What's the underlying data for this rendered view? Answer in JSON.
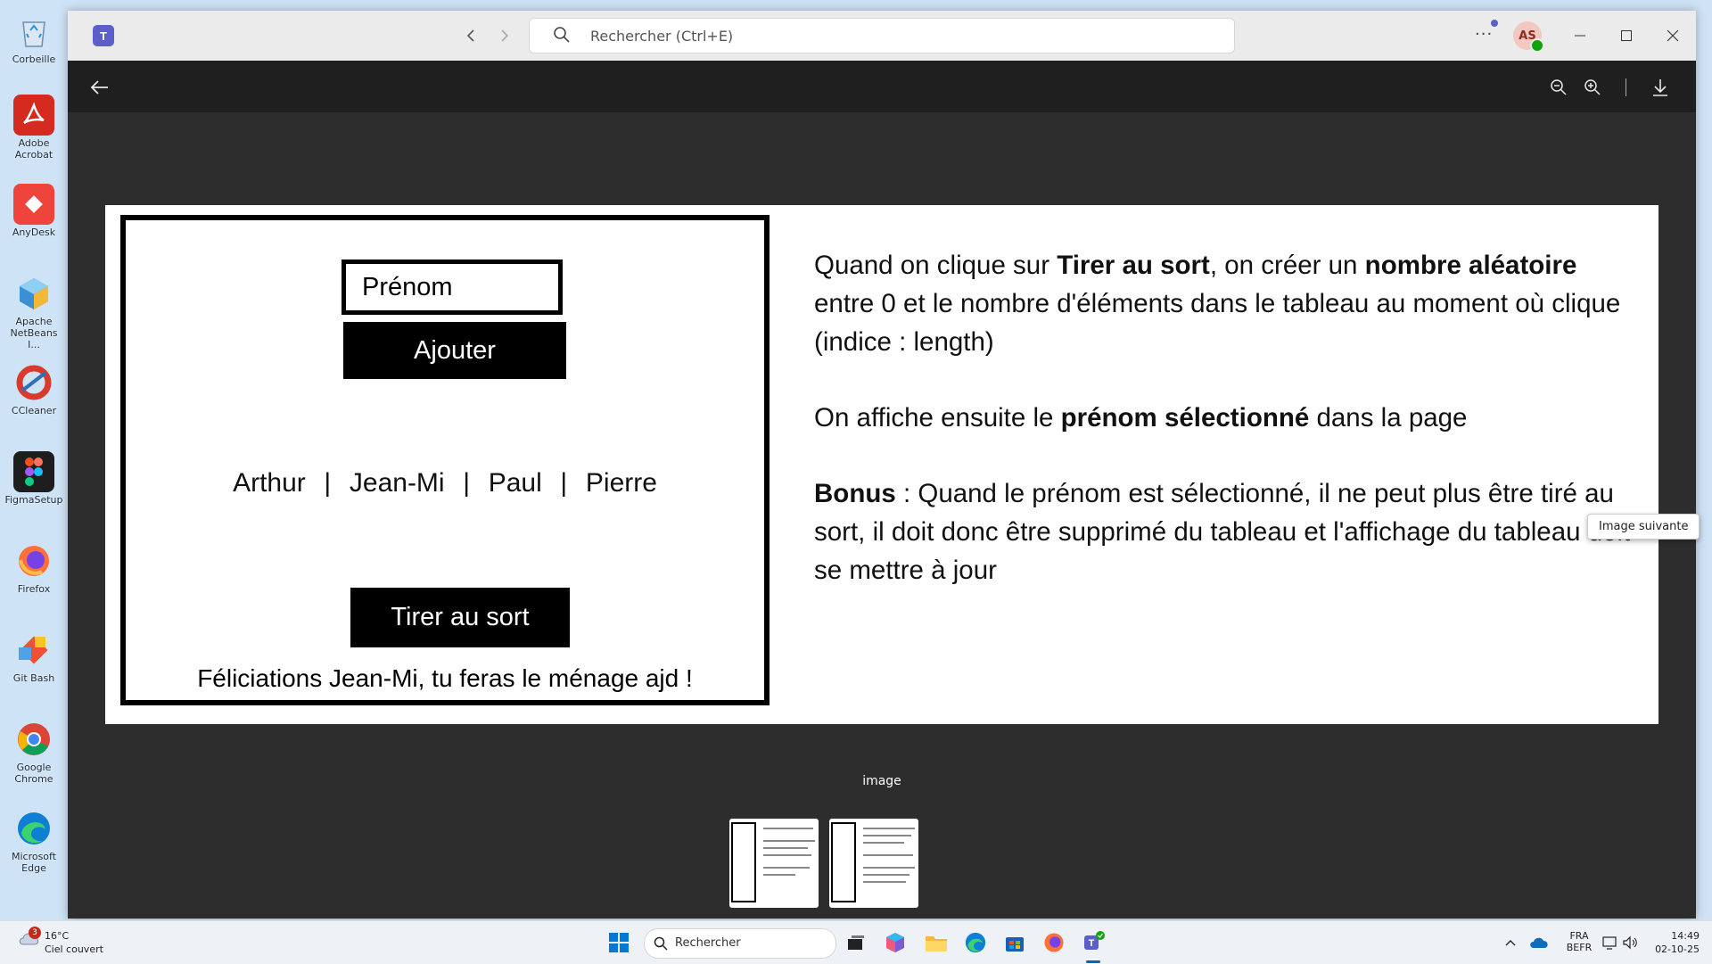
{
  "desktop": {
    "icons": [
      {
        "label": "Corbeille",
        "color": "#5aa0d8"
      },
      {
        "label": "Adobe Acrobat",
        "color": "#d42a1f"
      },
      {
        "label": "AnyDesk",
        "color": "#ef443b"
      },
      {
        "label": "Apache NetBeans I...",
        "color": "#3b8fd3"
      },
      {
        "label": "CCleaner",
        "color": "#d83b2b"
      },
      {
        "label": "FigmaSetup",
        "color": "#1e1e1e"
      },
      {
        "label": "Firefox",
        "color": "#ff7139"
      },
      {
        "label": "Git Bash",
        "color": "#f05033"
      },
      {
        "label": "Google Chrome",
        "color": "#4285f4"
      },
      {
        "label": "Microsoft Edge",
        "color": "#0f7fd4"
      }
    ]
  },
  "titlebar": {
    "search_placeholder": "Rechercher (Ctrl+E)",
    "avatar_initials": "AS"
  },
  "viewer": {
    "caption": "image",
    "tooltip": "Image suivante"
  },
  "slide": {
    "mockup": {
      "field_label": "Prénom",
      "add_button": "Ajouter",
      "names": "Arthur  |  Jean-Mi  |  Paul  |  Pierre",
      "draw_button": "Tirer au sort",
      "congrats": "Féliciations Jean-Mi, tu feras le ménage ajd !"
    },
    "explanation": {
      "p1_a": "Quand on clique sur ",
      "p1_b": "Tirer au sort",
      "p1_c": ", on créer un ",
      "p1_d": "nombre aléatoire",
      "p1_e": " entre 0 et le nombre d'éléments dans le tableau au moment où clique (indice : length)",
      "p2_a": "On affiche ensuite le ",
      "p2_b": "prénom sélectionné",
      "p2_c": " dans la page",
      "p3_a": "Bonus",
      "p3_b": " : Quand le prénom est sélectionné, il ne peut plus être tiré au sort, il doit donc être supprimé du tableau et l'affichage du tableau doit se mettre à jour"
    }
  },
  "taskbar": {
    "weather_temp": "16°C",
    "weather_desc": "Ciel couvert",
    "weather_badge": "3",
    "search_label": "Rechercher",
    "lang_1": "FRA",
    "lang_2": "BEFR",
    "time": "14:49",
    "date": "02-10-25"
  }
}
